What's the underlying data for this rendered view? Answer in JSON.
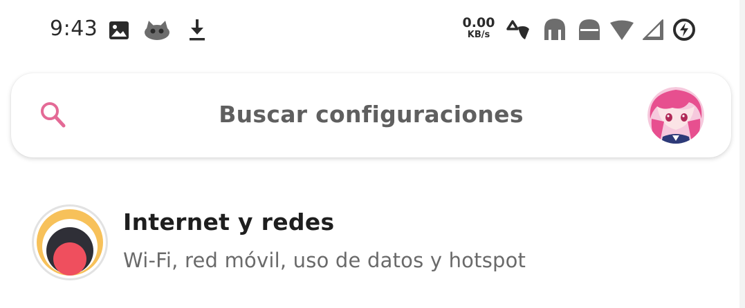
{
  "status_bar": {
    "time": "9:43",
    "net_speed_value": "0.00",
    "net_speed_unit": "KB/s",
    "left_icons": [
      "image-icon",
      "cat-app-icon",
      "download-icon"
    ],
    "right_icons": [
      "vpn-icon",
      "signal-icon",
      "signal-icon",
      "wifi-icon",
      "signal-icon",
      "battery-icon"
    ]
  },
  "search": {
    "placeholder": "Buscar configuraciones"
  },
  "settings": {
    "items": [
      {
        "title": "Internet y redes",
        "subtitle": "Wi-Fi, red móvil, uso de datos y hotspot"
      }
    ]
  },
  "colors": {
    "accent": "#e46a96",
    "icon_outer": "#f7c15a",
    "icon_dot": "#ef4f5e"
  }
}
